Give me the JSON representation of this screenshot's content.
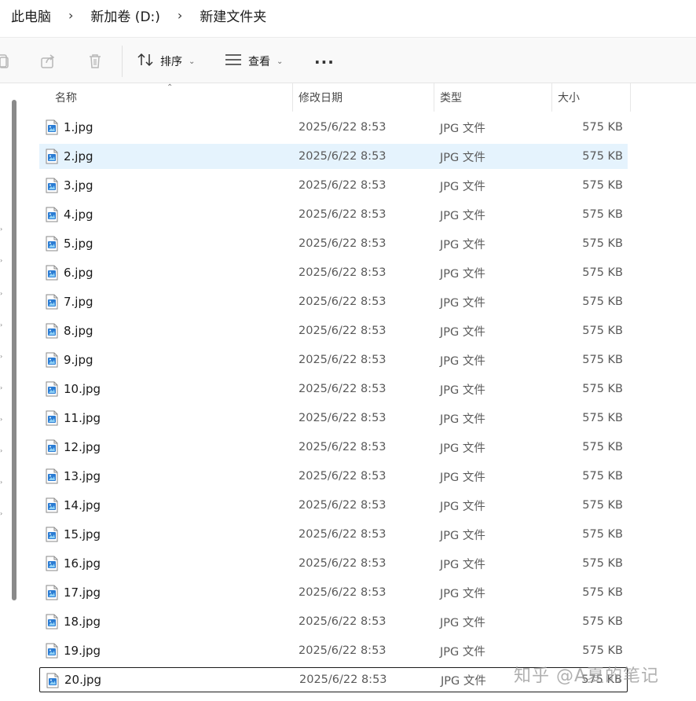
{
  "breadcrumb": {
    "items": [
      "此电脑",
      "新加卷 (D:)",
      "新建文件夹"
    ],
    "separator": "›"
  },
  "toolbar": {
    "sort_label": "排序",
    "view_label": "查看",
    "more_label": "···"
  },
  "columns": {
    "name": "名称",
    "date": "修改日期",
    "type": "类型",
    "size": "大小"
  },
  "files": [
    {
      "name": "1.jpg",
      "date": "2025/6/22 8:53",
      "type": "JPG 文件",
      "size": "575 KB"
    },
    {
      "name": "2.jpg",
      "date": "2025/6/22 8:53",
      "type": "JPG 文件",
      "size": "575 KB"
    },
    {
      "name": "3.jpg",
      "date": "2025/6/22 8:53",
      "type": "JPG 文件",
      "size": "575 KB"
    },
    {
      "name": "4.jpg",
      "date": "2025/6/22 8:53",
      "type": "JPG 文件",
      "size": "575 KB"
    },
    {
      "name": "5.jpg",
      "date": "2025/6/22 8:53",
      "type": "JPG 文件",
      "size": "575 KB"
    },
    {
      "name": "6.jpg",
      "date": "2025/6/22 8:53",
      "type": "JPG 文件",
      "size": "575 KB"
    },
    {
      "name": "7.jpg",
      "date": "2025/6/22 8:53",
      "type": "JPG 文件",
      "size": "575 KB"
    },
    {
      "name": "8.jpg",
      "date": "2025/6/22 8:53",
      "type": "JPG 文件",
      "size": "575 KB"
    },
    {
      "name": "9.jpg",
      "date": "2025/6/22 8:53",
      "type": "JPG 文件",
      "size": "575 KB"
    },
    {
      "name": "10.jpg",
      "date": "2025/6/22 8:53",
      "type": "JPG 文件",
      "size": "575 KB"
    },
    {
      "name": "11.jpg",
      "date": "2025/6/22 8:53",
      "type": "JPG 文件",
      "size": "575 KB"
    },
    {
      "name": "12.jpg",
      "date": "2025/6/22 8:53",
      "type": "JPG 文件",
      "size": "575 KB"
    },
    {
      "name": "13.jpg",
      "date": "2025/6/22 8:53",
      "type": "JPG 文件",
      "size": "575 KB"
    },
    {
      "name": "14.jpg",
      "date": "2025/6/22 8:53",
      "type": "JPG 文件",
      "size": "575 KB"
    },
    {
      "name": "15.jpg",
      "date": "2025/6/22 8:53",
      "type": "JPG 文件",
      "size": "575 KB"
    },
    {
      "name": "16.jpg",
      "date": "2025/6/22 8:53",
      "type": "JPG 文件",
      "size": "575 KB"
    },
    {
      "name": "17.jpg",
      "date": "2025/6/22 8:53",
      "type": "JPG 文件",
      "size": "575 KB"
    },
    {
      "name": "18.jpg",
      "date": "2025/6/22 8:53",
      "type": "JPG 文件",
      "size": "575 KB"
    },
    {
      "name": "19.jpg",
      "date": "2025/6/22 8:53",
      "type": "JPG 文件",
      "size": "575 KB"
    },
    {
      "name": "20.jpg",
      "date": "2025/6/22 8:53",
      "type": "JPG 文件",
      "size": "575 KB"
    }
  ],
  "selected_file": "2.jpg",
  "focused_file": "20.jpg",
  "icons": {
    "file": "jpg-file-icon",
    "copy": "copy-icon",
    "share": "share-icon",
    "delete": "delete-icon",
    "sort": "sort-icon",
    "view": "view-icon",
    "more": "more-icon"
  },
  "colors": {
    "selection": "#e5f3fd",
    "icon_blue": "#2b7cd3"
  },
  "watermark": "知乎 @A夏的笔记"
}
